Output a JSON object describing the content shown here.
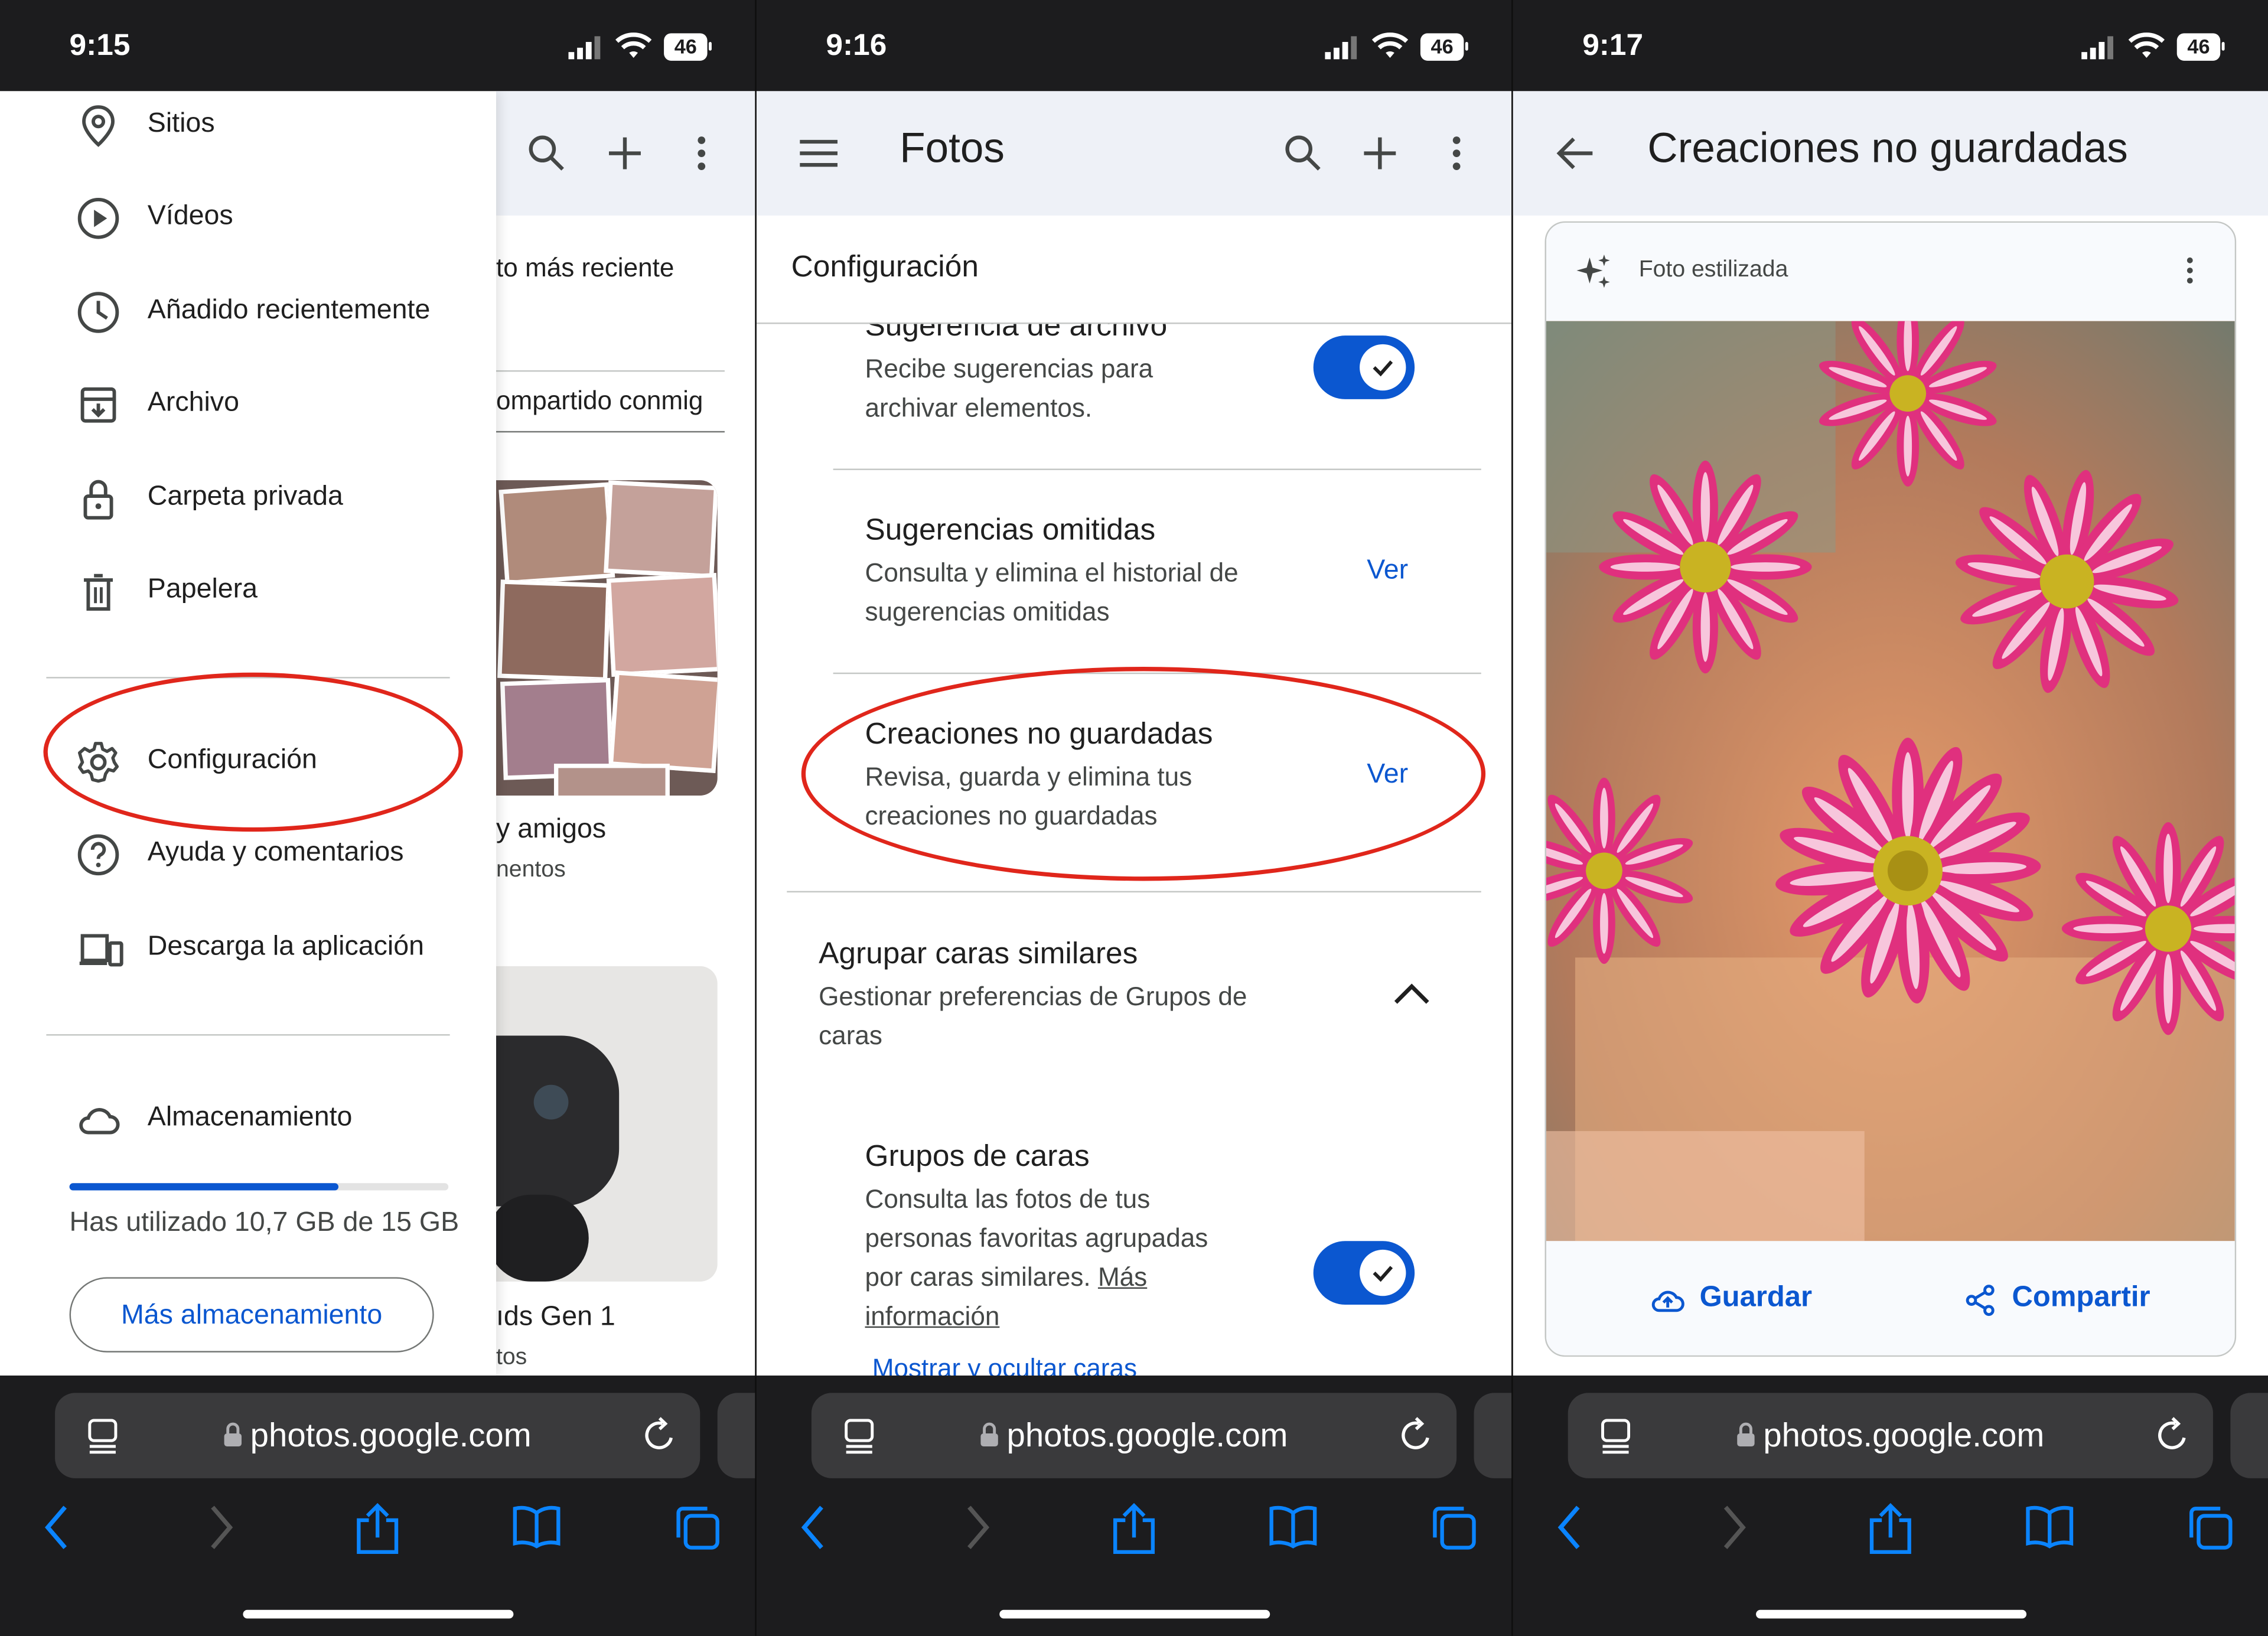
{
  "status_times": [
    "9:15",
    "9:16",
    "9:17"
  ],
  "battery": "46",
  "url": "photos.google.com",
  "panel1": {
    "menu": {
      "sitios": "Sitios",
      "videos": "Vídeos",
      "anadido": "Añadido recientemente",
      "archivo": "Archivo",
      "carpeta": "Carpeta privada",
      "papelera": "Papelera",
      "configuracion": "Configuración",
      "ayuda": "Ayuda y comentarios",
      "descarga": "Descarga la aplicación",
      "almacenamiento": "Almacenamiento"
    },
    "storage_used": "Has utilizado 10,7 GB de 15 GB",
    "storage_fraction": 0.71,
    "more_storage": "Más almacenamiento",
    "background": {
      "recent": "to más reciente",
      "shared": "ompartido conmig",
      "album1_title": "y amigos",
      "album1_sub": "nentos",
      "album2_title": "ıds Gen 1",
      "album2_sub": "tos"
    }
  },
  "panel2": {
    "title": "Fotos",
    "section": "Configuración",
    "items": [
      {
        "title": "Sugerencia de archivo",
        "desc": "Recibe sugerencias para archivar elementos."
      },
      {
        "title": "Sugerencias omitidas",
        "desc": "Consulta y elimina el historial de sugerencias omitidas",
        "action": "Ver"
      },
      {
        "title": "Creaciones no guardadas",
        "desc": "Revisa, guarda y elimina tus creaciones no guardadas",
        "action": "Ver"
      },
      {
        "title": "Agrupar caras similares",
        "desc": "Gestionar preferencias de Grupos de caras"
      },
      {
        "title": "Grupos de caras",
        "desc": "Consulta las fotos de tus personas favoritas agrupadas por caras similares.",
        "link": "Más información"
      }
    ],
    "bottom_link": "Mostrar y ocultar caras"
  },
  "panel3": {
    "title": "Creaciones no guardadas",
    "card_label": "Foto estilizada",
    "save": "Guardar",
    "share": "Compartir"
  },
  "colors": {
    "accent": "#0b57d0",
    "highlight": "#e0261b",
    "topbar": "#eef1f7",
    "safari_bg": "#1c1c1e"
  }
}
